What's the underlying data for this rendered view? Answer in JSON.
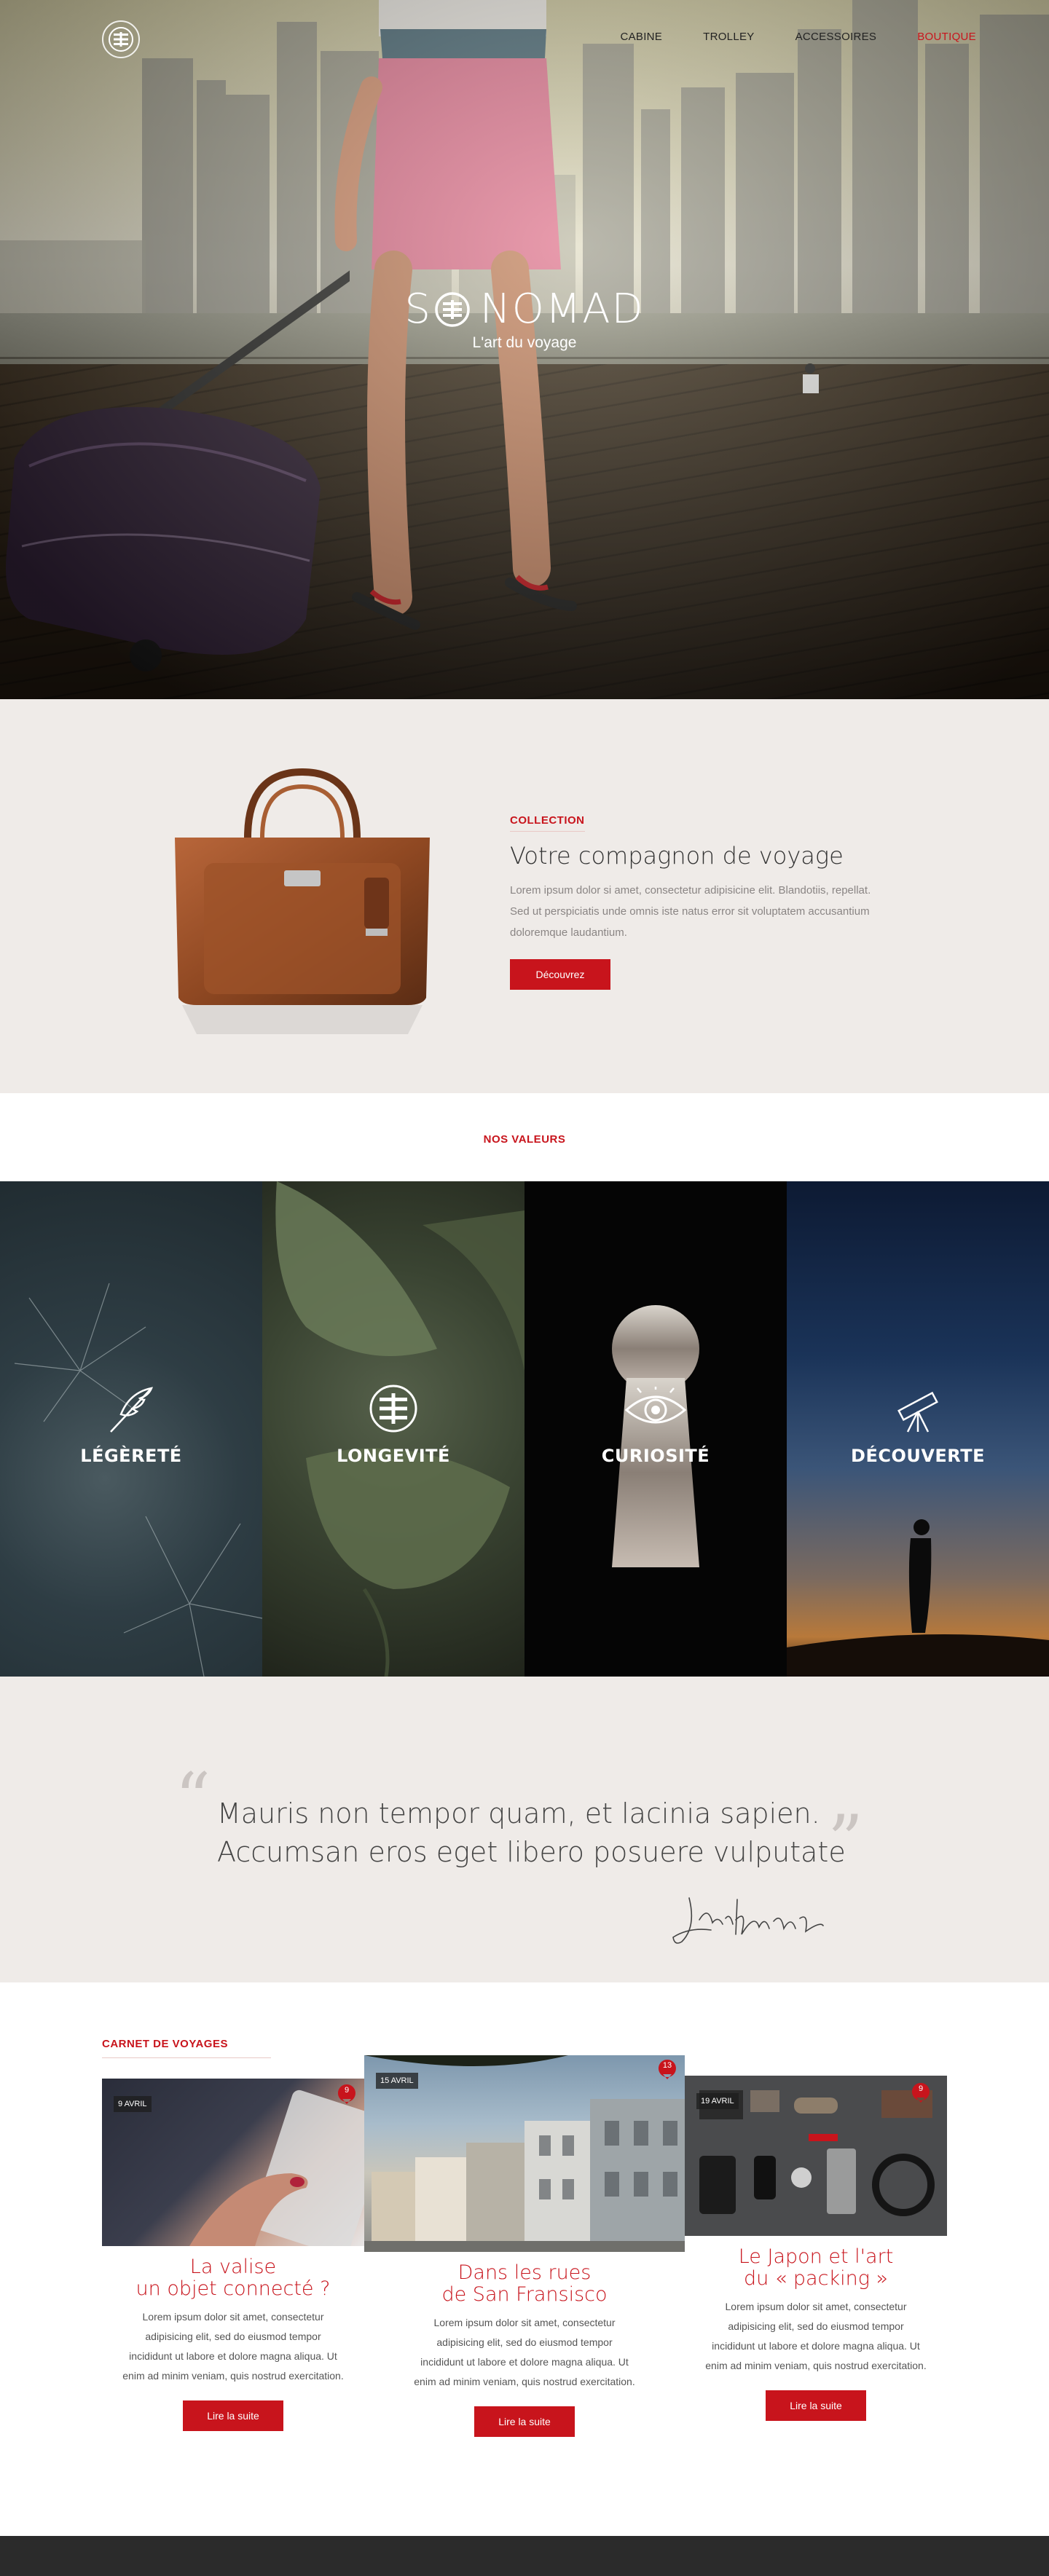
{
  "nav": {
    "items": [
      {
        "label": "CABINE",
        "active": false
      },
      {
        "label": "TROLLEY",
        "active": false
      },
      {
        "label": "ACCESSOIRES",
        "active": false
      },
      {
        "label": "BOUTIQUE",
        "active": true
      }
    ]
  },
  "hero": {
    "brand_left": "S",
    "brand_right": "NOMAD",
    "tagline": "L'art du voyage"
  },
  "collection": {
    "eyebrow": "COLLECTION",
    "title": "Votre compagnon de voyage",
    "body": "Lorem ipsum dolor si amet, consectetur adipisicine elit. Blandotiis, repellat. Sed ut perspiciatis unde omnis iste natus error sit voluptatem accusantium doloremque laudantium.",
    "button": "Découvrez"
  },
  "valeurs": {
    "heading": "NOS VALEURS",
    "tiles": [
      {
        "label": "LÉGÈRETÉ",
        "icon": "feather-icon"
      },
      {
        "label": "LONGEVITÉ",
        "icon": "longevity-emblem-icon"
      },
      {
        "label": "CURIOSITÉ",
        "icon": "eye-icon"
      },
      {
        "label": "DÉCOUVERTE",
        "icon": "telescope-icon"
      }
    ]
  },
  "quote": {
    "line1": "Mauris non tempor quam, et lacinia sapien.",
    "line2": "Accumsan eros eget libero posuere vulputate",
    "open_mark": "“",
    "close_mark": "”",
    "signature": "Jack Kerouac"
  },
  "carnet": {
    "heading": "CARNET DE VOYAGES",
    "posts": [
      {
        "date": "9 AVRIL",
        "comments": "9",
        "title_line1": "La valise",
        "title_line2": "un objet connecté ?",
        "body": "Lorem ipsum dolor sit amet, consectetur adipisicing elit, sed do eiusmod tempor incididunt ut labore et dolore magna aliqua. Ut enim ad minim veniam, quis nostrud exercitation.",
        "button": "Lire la suite"
      },
      {
        "date": "15 AVRIL",
        "comments": "13",
        "title_line1": "Dans les rues",
        "title_line2": "de San Fransisco",
        "body": "Lorem ipsum dolor sit amet, consectetur adipisicing elit, sed do eiusmod tempor incididunt ut labore et dolore magna aliqua. Ut enim ad minim veniam, quis nostrud exercitation.",
        "button": "Lire la suite"
      },
      {
        "date": "19 AVRIL",
        "comments": "9",
        "title_line1": "Le Japon et l'art",
        "title_line2": "du « packing »",
        "body": "Lorem ipsum dolor sit amet, consectetur adipisicing elit, sed do eiusmod tempor incididunt ut labore et dolore magna aliqua. Ut enim ad minim veniam, quis nostrud exercitation.",
        "button": "Lire la suite"
      }
    ]
  },
  "colors": {
    "accent": "#c8141c",
    "section_bg": "#efebe8",
    "footer_bg": "#2b2b2b"
  }
}
